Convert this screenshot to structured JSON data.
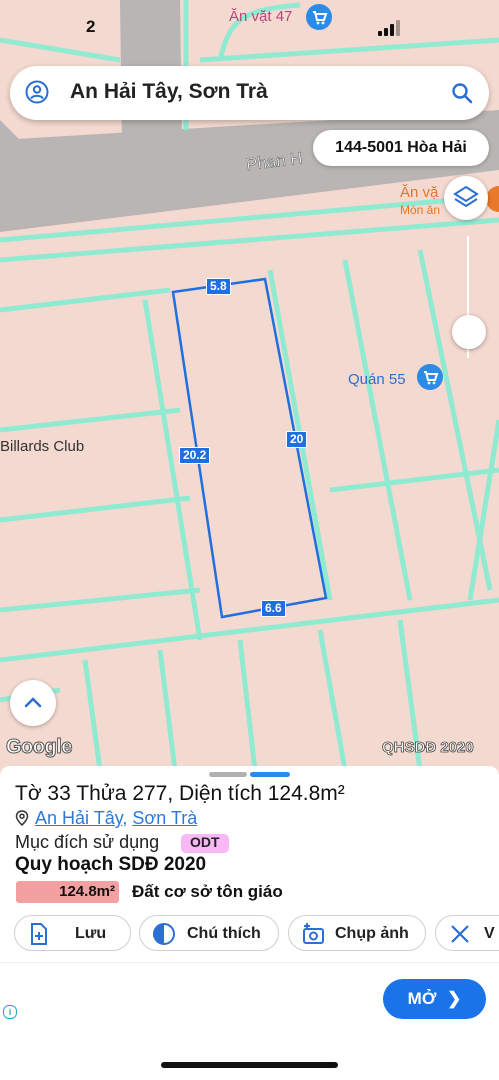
{
  "status_bar": {
    "time": "2"
  },
  "search": {
    "query": "An Hải Tây, Sơn Trà"
  },
  "parcel_chip": {
    "label": "144-5001 Hòa Hải"
  },
  "map": {
    "labels": {
      "street": "Phan H",
      "billiards": "Billards Club"
    },
    "pois": {
      "an_vat_47": "Ăn vặt 47",
      "an_vat_partial": "Ăn vặ",
      "mon_an_partial": "Món ăn",
      "quan_55": "Quán 55"
    },
    "dimensions": {
      "top": "5.8",
      "left": "20.2",
      "right": "20",
      "bottom": "6.6"
    },
    "google_logo": "Google",
    "overlay_tag": "QHSDĐ 2020"
  },
  "sheet": {
    "title": "Tờ 33 Thửa 277, Diện tích 124.8m²",
    "ward": "An Hải Tây",
    "separator": ", ",
    "district": "Sơn Trà",
    "purpose_label": "Mục đích sử dụng",
    "purpose_code": "ODT",
    "plan_title": "Quy hoạch SDĐ 2020",
    "area_badge": "124.8m²",
    "land_use": "Đất cơ sở tôn giáo",
    "actions": {
      "save": "Lưu",
      "annotate": "Chú thích",
      "photo": "Chụp ảnh",
      "more_partial": "V"
    }
  },
  "ad": {
    "open_label": "MỞ",
    "info": "i"
  },
  "colors": {
    "parcel_outline": "#1f6fe0",
    "boundary": "#7be8d0",
    "land": "#f3d9cf",
    "road": "#b8b4b4",
    "accent": "#1a73e8",
    "area_badge": "#f2a0a0",
    "odt_badge": "#f7b8f5"
  }
}
